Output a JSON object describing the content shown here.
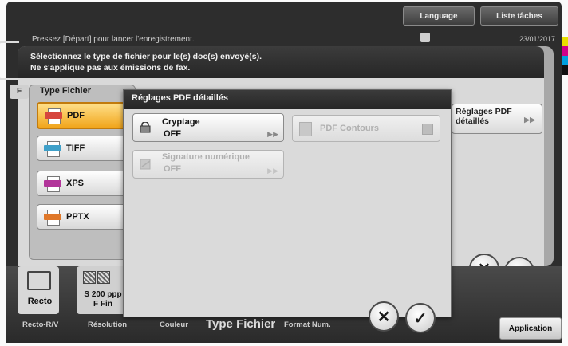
{
  "top_bar": {
    "language_label": "Language",
    "task_list_label": "Liste tâches"
  },
  "status": {
    "message": "Pressez [Départ] pour lancer l'enregistrement.",
    "date": "23/01/2017"
  },
  "back_dialog": {
    "instruction_line1": "Sélectionnez le type de fichier pour le(s) doc(s) envoyé(s).",
    "instruction_line2": "Ne s'applique pas aux émissions de fax.",
    "tab_letter": "F",
    "file_type_title": "Type Fichier",
    "file_types": [
      {
        "label": "PDF",
        "selected": true
      },
      {
        "label": "TIFF",
        "selected": false
      },
      {
        "label": "XPS",
        "selected": false
      },
      {
        "label": "PPTX",
        "selected": false
      }
    ],
    "right_button_line1": "Réglages PDF",
    "right_button_line2": "détaillés"
  },
  "modal": {
    "title": "Réglages PDF détaillés",
    "encryption": {
      "label": "Cryptage",
      "value": "OFF",
      "enabled": true
    },
    "digital_signature": {
      "label": "Signature numérique",
      "value": "OFF",
      "enabled": false
    },
    "pdf_outline": {
      "label": "PDF Contours",
      "enabled": false
    }
  },
  "bottom": {
    "recto_label": "Recto",
    "resolution_line1": "S 200 ppp",
    "resolution_line2": "F Fin",
    "labels": {
      "recto_verso": "Recto-R/V",
      "resolution": "Résolution",
      "color": "Couleur",
      "file_type": "Type Fichier",
      "file_format": "Format Num."
    },
    "application_label": "Application"
  },
  "colors": {
    "selected_orange": "#f1a51c",
    "title_bar": "#2e2e2e",
    "panel_gray": "#d9d9d9",
    "disabled_text": "#b0b0b0"
  },
  "icons": [
    "pdf-file-icon",
    "tiff-file-icon",
    "xps-file-icon",
    "pptx-file-icon",
    "lock-icon",
    "signature-icon",
    "outline-icon",
    "close-icon",
    "ok-check-icon",
    "memory-icon"
  ]
}
